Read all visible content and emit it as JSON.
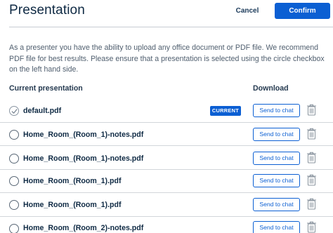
{
  "header": {
    "title": "Presentation",
    "cancel_label": "Cancel",
    "confirm_label": "Confirm"
  },
  "description": "As a presenter you have the ability to upload any office document or PDF file. We recommend PDF file for best results. Please ensure that a presentation is selected using the circle checkbox on the left hand side.",
  "table": {
    "columns": {
      "current": "Current presentation",
      "download": "Download"
    },
    "current_badge": "CURRENT",
    "send_label": "Send to chat",
    "rows": [
      {
        "name": "default.pdf",
        "selected": true,
        "current": true
      },
      {
        "name": "Home_Room_(Room_1)-notes.pdf",
        "selected": false,
        "current": false
      },
      {
        "name": "Home_Room_(Room_1)-notes.pdf",
        "selected": false,
        "current": false
      },
      {
        "name": "Home_Room_(Room_1).pdf",
        "selected": false,
        "current": false
      },
      {
        "name": "Home_Room_(Room_1).pdf",
        "selected": false,
        "current": false
      },
      {
        "name": "Home_Room_(Room_2)-notes.pdf",
        "selected": false,
        "current": false
      }
    ]
  },
  "colors": {
    "accent": "#0b5fd3",
    "text_dark": "#0f2a44",
    "text_muted": "#4f5e6e"
  },
  "icons": {
    "check": "check-icon",
    "trash": "trash-icon"
  }
}
